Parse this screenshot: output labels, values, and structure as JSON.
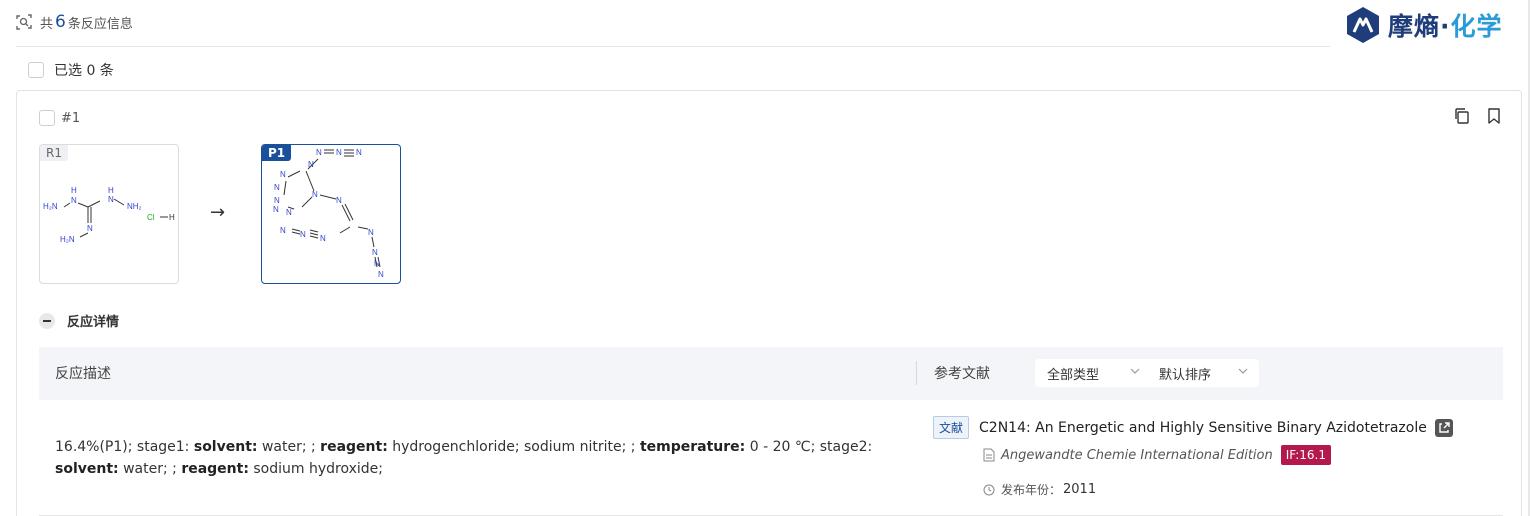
{
  "header": {
    "count_prefix": "共",
    "count": "6",
    "count_suffix": "条反应信息",
    "scan_icon": "scan-icon"
  },
  "brand": {
    "name_part1": "摩熵·",
    "name_part2": "化学",
    "primary_color": "#1f3d7a",
    "accent_color": "#2a9ad8"
  },
  "selection": {
    "label": "已选 0 条"
  },
  "reaction": {
    "id_label": "#1",
    "reactant_tag": "R1",
    "product_tag": "P1",
    "arrow": "→",
    "reactant_atoms": [
      "H₂N",
      "H",
      "N",
      "H",
      "N",
      "NH₂",
      "N",
      "H₂N",
      "Cl",
      "H"
    ],
    "product_atoms": [
      "N",
      "N",
      "N",
      "N",
      "N",
      "N",
      "N",
      "N",
      "N",
      "N",
      "N",
      "N",
      "N",
      "N",
      "N",
      "N",
      "N",
      "N"
    ],
    "details_label": "反应详情",
    "table_header": {
      "description": "反应描述",
      "reference": "参考文献",
      "type_select": "全部类型",
      "sort_select": "默认排序"
    },
    "description": {
      "t1": "16.4%(P1); stage1: ",
      "k1": "solvent:",
      "t2": " water; ; ",
      "k2": "reagent:",
      "t3": " hydrogenchloride; sodium nitrite; ; ",
      "k3": "temperature:",
      "t4": " 0 - 20 ℃; stage2: ",
      "k4": "solvent:",
      "t5": " water; ; ",
      "k5": "reagent:",
      "t6": " sodium hydroxide;"
    },
    "reference": {
      "badge": "文献",
      "title": "C2N14: An Energetic and Highly Sensitive Binary Azidotetrazole",
      "journal": "Angewandte Chemie International Edition",
      "impact_factor": "IF:16.1",
      "year_label": "发布年份：",
      "year": "2011"
    }
  }
}
